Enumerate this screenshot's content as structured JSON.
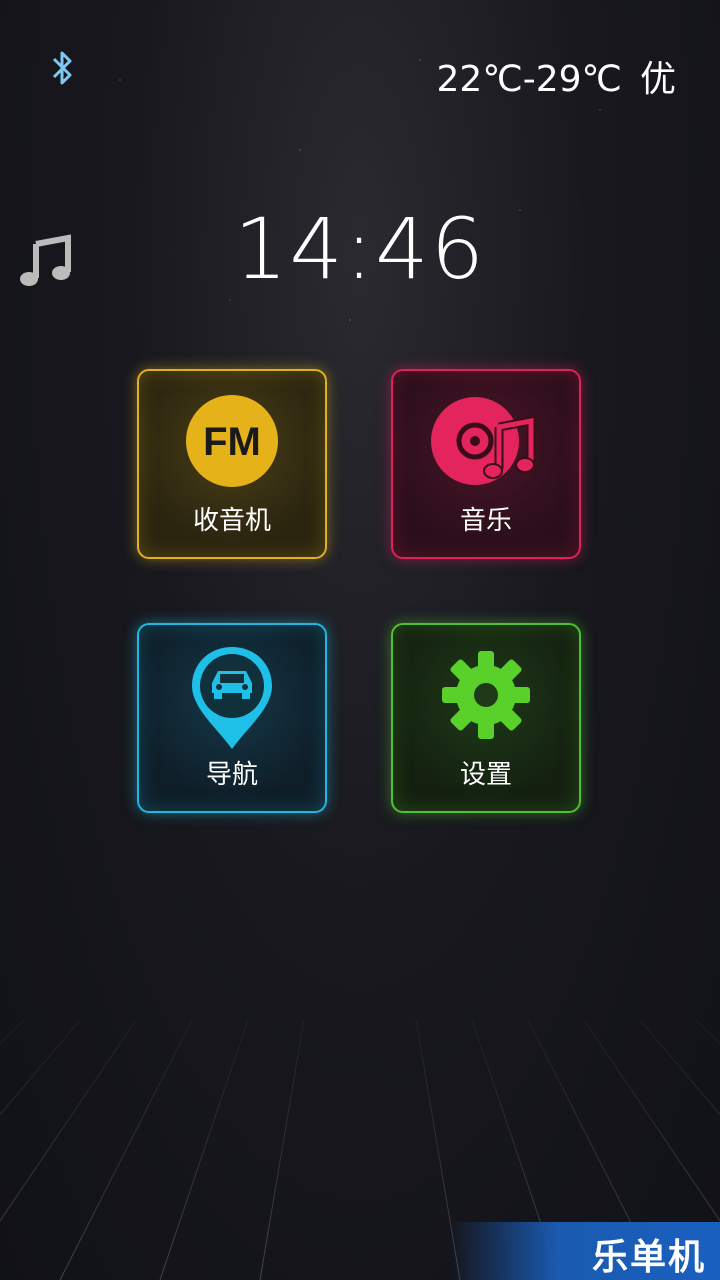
{
  "status": {
    "bluetooth_icon": "bluetooth-icon",
    "temperature": "22℃-29℃",
    "air_quality": "优"
  },
  "side": {
    "music_icon": "music-note-icon"
  },
  "clock": {
    "time": "14:46"
  },
  "tiles": [
    {
      "label": "收音机",
      "icon": "fm-radio-icon",
      "color": "#e0b020"
    },
    {
      "label": "音乐",
      "icon": "music-disc-icon",
      "color": "#e0205a"
    },
    {
      "label": "导航",
      "icon": "navigation-car-icon",
      "color": "#20b8e0"
    },
    {
      "label": "设置",
      "icon": "gear-icon",
      "color": "#50c030"
    }
  ],
  "watermark": {
    "text": "乐单机"
  }
}
